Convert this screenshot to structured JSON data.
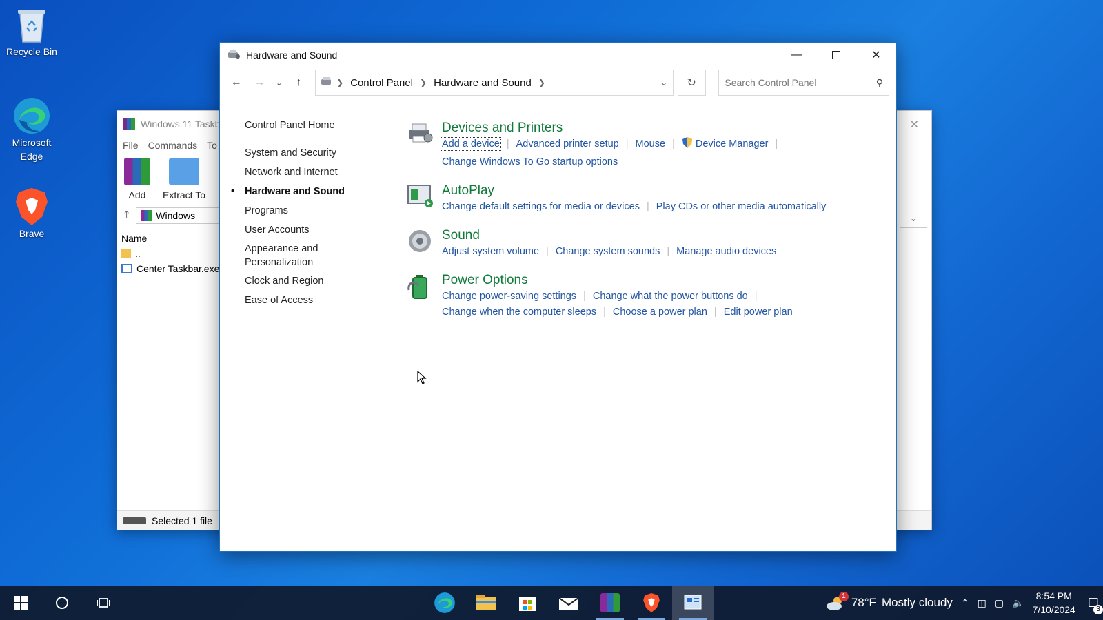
{
  "desktop": {
    "icons": [
      {
        "label": "Recycle Bin"
      },
      {
        "label": "Microsoft Edge"
      },
      {
        "label": "Brave"
      }
    ]
  },
  "bg_window": {
    "title": "Windows 11 Taskb",
    "menu": [
      "File",
      "Commands",
      "To"
    ],
    "tools": [
      "Add",
      "Extract To"
    ],
    "address": "Windows",
    "column": "Name",
    "rows": [
      "..",
      "Center Taskbar.exe"
    ],
    "status": "Selected 1 file"
  },
  "window": {
    "title": "Hardware and Sound",
    "breadcrumb": [
      "Control Panel",
      "Hardware and Sound"
    ],
    "search_placeholder": "Search Control Panel"
  },
  "sidebar": {
    "home": "Control Panel Home",
    "items": [
      {
        "label": "System and Security",
        "active": false
      },
      {
        "label": "Network and Internet",
        "active": false
      },
      {
        "label": "Hardware and Sound",
        "active": true
      },
      {
        "label": "Programs",
        "active": false
      },
      {
        "label": "User Accounts",
        "active": false
      },
      {
        "label": "Appearance and Personalization",
        "active": false
      },
      {
        "label": "Clock and Region",
        "active": false
      },
      {
        "label": "Ease of Access",
        "active": false
      }
    ]
  },
  "categories": [
    {
      "title": "Devices and Printers",
      "icon": "printer-icon",
      "links": [
        "Add a device",
        "Advanced printer setup",
        "Mouse",
        "Device Manager",
        "Change Windows To Go startup options"
      ]
    },
    {
      "title": "AutoPlay",
      "icon": "autoplay-icon",
      "links": [
        "Change default settings for media or devices",
        "Play CDs or other media automatically"
      ]
    },
    {
      "title": "Sound",
      "icon": "speaker-icon",
      "links": [
        "Adjust system volume",
        "Change system sounds",
        "Manage audio devices"
      ]
    },
    {
      "title": "Power Options",
      "icon": "battery-icon",
      "links": [
        "Change power-saving settings",
        "Change what the power buttons do",
        "Change when the computer sleeps",
        "Choose a power plan",
        "Edit power plan"
      ]
    }
  ],
  "taskbar": {
    "weather_temp": "78°F",
    "weather_text": "Mostly cloudy",
    "weather_badge": "1",
    "time": "8:54 PM",
    "date": "7/10/2024",
    "notification_count": "3"
  },
  "colors": {
    "category_title": "#117a3b",
    "link": "#2356a3",
    "desktop": "#1572d8",
    "taskbar": "#0f192d"
  }
}
